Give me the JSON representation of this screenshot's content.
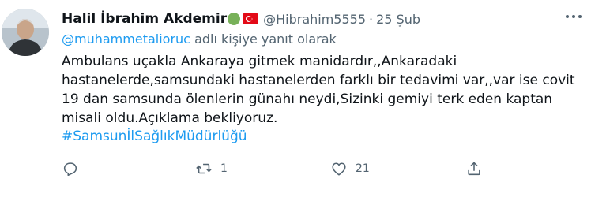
{
  "tweet": {
    "display_name": "Halil İbrahim Akdemir",
    "handle": "@Hibrahim5555",
    "separator": "·",
    "time": "25 Şub",
    "reply_to": {
      "mention": "@muhammetalioruc",
      "suffix": "adlı kişiye yanıt olarak"
    },
    "body_lines": [
      "Ambulans uçakla Ankaraya gitmek manidardır,,Ankaradaki",
      "hastanelerde,samsundaki hastanelerden farklı bir tedavimi var,,var ise covit",
      "19 dan samsunda ölenlerin günahı neydi,Sizinki gemiyi terk eden kaptan",
      "misali oldu.Açıklama bekliyoruz."
    ],
    "hashtag": "#SamsunİlSağlıkMüdürlüğü",
    "actions": {
      "reply_count": "",
      "retweet_count": "1",
      "like_count": "21"
    }
  },
  "icons": {
    "avatar": "user-avatar",
    "green_circle": "green-circle-emoji",
    "flag": "turkey-flag-emoji",
    "more": "more-icon",
    "reply": "reply-icon",
    "retweet": "retweet-icon",
    "like": "heart-icon",
    "share": "share-icon"
  },
  "colors": {
    "accent": "#1d9bf0",
    "secondary_text": "#536471",
    "primary_text": "#0f1419"
  }
}
